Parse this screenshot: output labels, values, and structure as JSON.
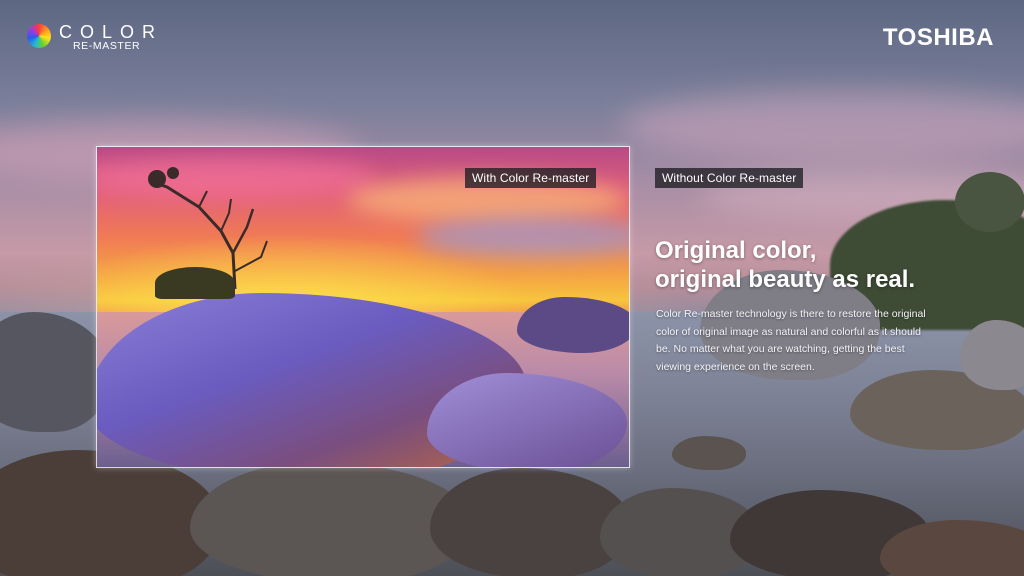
{
  "logo": {
    "wordmark": "COLOR",
    "subtitle": "RE-MASTER",
    "icon": "color-wheel-icon"
  },
  "brand": "TOSHIBA",
  "labels": {
    "with": "With Color Re-master",
    "without": "Without Color Re-master"
  },
  "headline": {
    "line1": "Original color,",
    "line2": "original beauty as real."
  },
  "body": {
    "line1": "Color Re-master technology is there to restore the original",
    "line2": "color of original image as natural and colorful as it should",
    "line3": "be. No matter what you are watching, getting the best",
    "line4": "viewing experience on the screen."
  },
  "colors": {
    "text": "#ffffff",
    "label_bg": "#1e1e23",
    "frame_border": "#ffffff"
  }
}
